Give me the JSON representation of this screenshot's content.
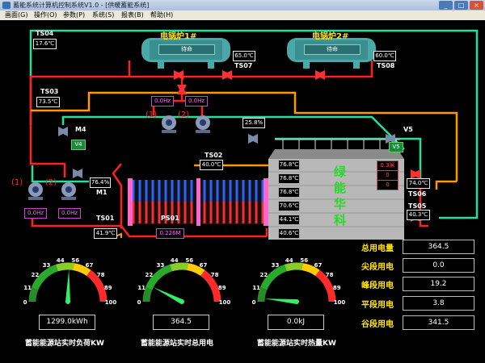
{
  "window": {
    "title": "蓄能系统计算机控制系统V1.0 - [供暖蓄能系统]"
  },
  "menu": [
    {
      "label": "画面(G)"
    },
    {
      "label": "操作(O)"
    },
    {
      "label": "参数(P)"
    },
    {
      "label": "系统(S)"
    },
    {
      "label": "报表(B)"
    },
    {
      "label": "帮助(H)"
    }
  ],
  "boilers": [
    {
      "name": "电锅炉1#",
      "status": "待命",
      "temp": "65.0℃",
      "sensor": "TS07"
    },
    {
      "name": "电锅炉2#",
      "status": "待命",
      "temp": "60.0℃",
      "sensor": "TS08"
    }
  ],
  "sensors": {
    "ts04": {
      "name": "TS04",
      "value": "17.6℃"
    },
    "ts03": {
      "name": "TS03",
      "value": "73.5℃"
    },
    "ts02": {
      "name": "TS02",
      "value": "40.0℃"
    },
    "ts01": {
      "name": "TS01",
      "value": "41.9℃"
    },
    "ts06": {
      "name": "TS06",
      "value": "74.0℃"
    },
    "ts05": {
      "name": "TS05",
      "value": "40.3℃"
    },
    "ps01": {
      "name": "PS01",
      "value": "0.226M"
    }
  },
  "valves": {
    "m4": {
      "name": "M4",
      "value": "V4"
    },
    "m1": {
      "name": "M1",
      "value": "76.4%"
    },
    "v5": {
      "name": "V5",
      "value": "V5"
    },
    "mid": {
      "value": "25.8%"
    }
  },
  "pumps_top": [
    {
      "index": "(1)",
      "freq": "0.0Hz"
    },
    {
      "index": "(2)",
      "freq": "0.0Hz"
    }
  ],
  "pumps_bottom": [
    {
      "index": "(1)",
      "freq": "0.0Hz"
    },
    {
      "index": "(2)",
      "freq": "0.0Hz"
    }
  ],
  "tank": {
    "label_chars": [
      "绿",
      "能",
      "华",
      "科"
    ],
    "temps": [
      "76.8℃",
      "76.8℃",
      "76.8℃",
      "70.6℃",
      "44.1℃",
      "40.6℃"
    ],
    "side_values": [
      "0.3米",
      "0",
      "0"
    ]
  },
  "energy": [
    {
      "label": "总用电量",
      "value": "364.5"
    },
    {
      "label": "尖段用电",
      "value": "0.0"
    },
    {
      "label": "峰段用电",
      "value": "19.2"
    },
    {
      "label": "平段用电",
      "value": "3.8"
    },
    {
      "label": "谷段用电",
      "value": "341.5"
    }
  ],
  "gauges": [
    {
      "ticks": [
        "0",
        "11",
        "22",
        "33",
        "44",
        "56",
        "67",
        "78",
        "89",
        "100"
      ],
      "value": "1299.0kWh",
      "caption": "蓄能能源站实时负荷KW",
      "reading": 51
    },
    {
      "ticks": [
        "0",
        "11",
        "22",
        "33",
        "44",
        "56",
        "67",
        "78",
        "89",
        "100"
      ],
      "value": "364.5",
      "caption": "蓄能能源站实时总用电",
      "reading": 15
    },
    {
      "ticks": [
        "0",
        "11",
        "22",
        "33",
        "44",
        "56",
        "67",
        "78",
        "89",
        "100"
      ],
      "value": "0.0kJ",
      "caption": "蓄能能源站实时热量KW",
      "reading": 3
    }
  ],
  "colors": {
    "hot": "#ff2020",
    "cold": "#20e0a0",
    "return": "#ff9900",
    "text_yellow": "#ffe600"
  }
}
